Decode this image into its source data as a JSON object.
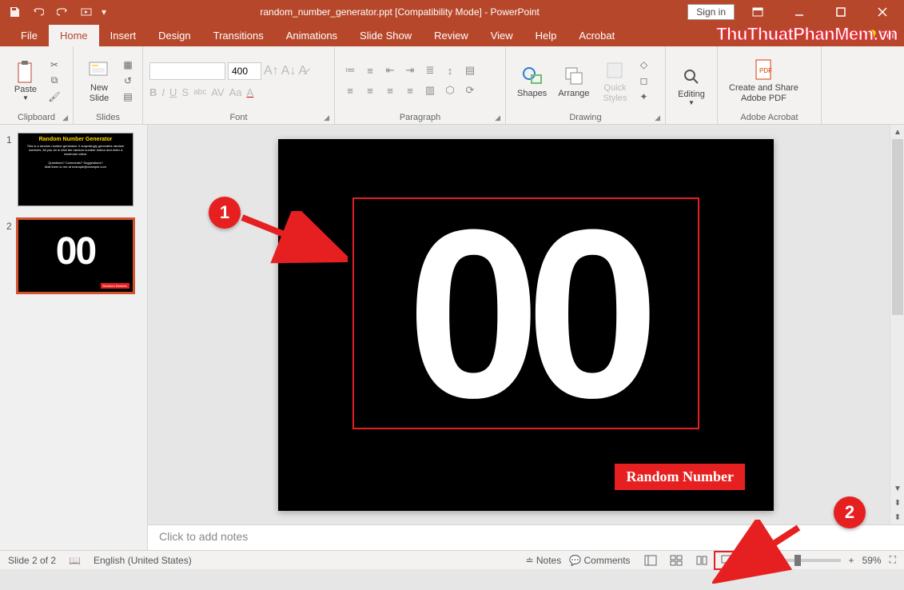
{
  "titlebar": {
    "document_title": "random_number_generator.ppt [Compatibility Mode] - PowerPoint",
    "signin": "Sign in"
  },
  "watermark": "ThuThuatPhanMem.vn",
  "tabs": {
    "file": "File",
    "home": "Home",
    "insert": "Insert",
    "design": "Design",
    "transitions": "Transitions",
    "animations": "Animations",
    "slideshow": "Slide Show",
    "review": "Review",
    "view": "View",
    "help": "Help",
    "acrobat": "Acrobat",
    "tellme": "Tell"
  },
  "ribbon": {
    "clipboard": {
      "paste": "Paste",
      "label": "Clipboard"
    },
    "slides": {
      "newslide": "New\nSlide",
      "label": "Slides"
    },
    "font": {
      "size": "400",
      "label": "Font"
    },
    "paragraph": {
      "label": "Paragraph"
    },
    "drawing": {
      "shapes": "Shapes",
      "arrange": "Arrange",
      "quickstyles": "Quick\nStyles",
      "label": "Drawing"
    },
    "editing": {
      "label": "Editing"
    },
    "adobe": {
      "create": "Create and Share\nAdobe PDF",
      "label": "Adobe Acrobat"
    }
  },
  "thumbnails": {
    "s1": {
      "num": "1",
      "title": "Random Number Generator"
    },
    "s2": {
      "num": "2",
      "number": "00",
      "btn": "Random Number"
    }
  },
  "slide": {
    "number": "00",
    "button": "Random Number"
  },
  "notes_placeholder": "Click to add notes",
  "status": {
    "slide": "Slide 2 of 2",
    "lang": "English (United States)",
    "notes": "Notes",
    "comments": "Comments",
    "zoom": "59%"
  },
  "annotations": {
    "one": "1",
    "two": "2"
  }
}
